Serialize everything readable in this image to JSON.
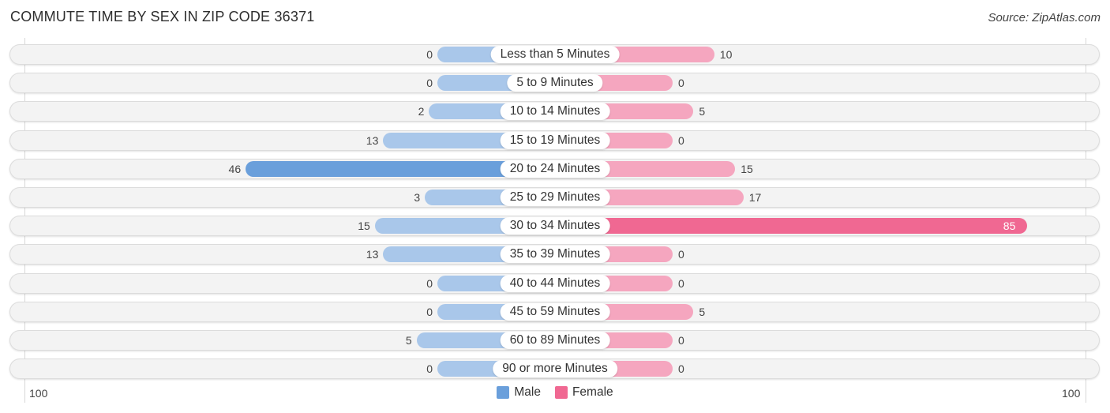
{
  "header": {
    "title": "COMMUTE TIME BY SEX IN ZIP CODE 36371",
    "source": "Source: ZipAtlas.com"
  },
  "colors": {
    "male": "#a9c7ea",
    "male_strong": "#6a9fdb",
    "female": "#f5a6bf",
    "female_strong": "#f06892"
  },
  "chart_data": {
    "type": "bar",
    "orientation": "horizontal-diverging",
    "title": "COMMUTE TIME BY SEX IN ZIP CODE 36371",
    "categories": [
      "Less than 5 Minutes",
      "5 to 9 Minutes",
      "10 to 14 Minutes",
      "15 to 19 Minutes",
      "20 to 24 Minutes",
      "25 to 29 Minutes",
      "30 to 34 Minutes",
      "35 to 39 Minutes",
      "40 to 44 Minutes",
      "45 to 59 Minutes",
      "60 to 89 Minutes",
      "90 or more Minutes"
    ],
    "series": [
      {
        "name": "Male",
        "values": [
          0,
          0,
          2,
          13,
          46,
          3,
          15,
          13,
          0,
          0,
          5,
          0
        ]
      },
      {
        "name": "Female",
        "values": [
          10,
          0,
          5,
          0,
          15,
          17,
          85,
          0,
          0,
          5,
          0,
          0
        ]
      }
    ],
    "axis": {
      "left_label": "100",
      "right_label": "100",
      "range": [
        -100,
        100
      ]
    },
    "legend": {
      "position": "bottom-center",
      "items": [
        "Male",
        "Female"
      ]
    },
    "grid": false
  }
}
